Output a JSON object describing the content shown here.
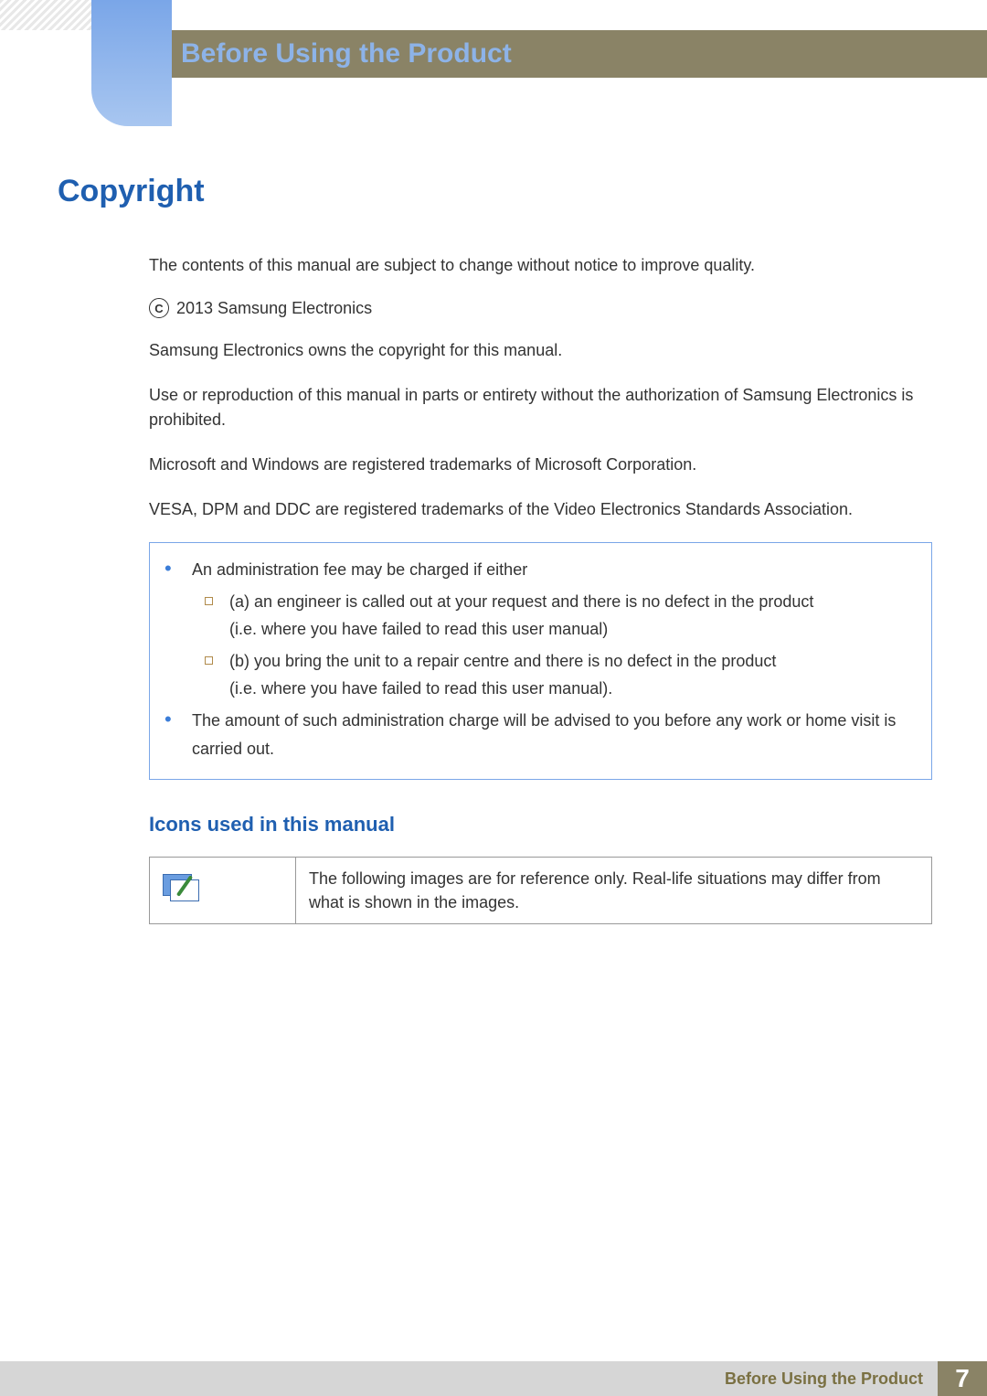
{
  "header": {
    "title": "Before Using the Product"
  },
  "section": {
    "title": "Copyright"
  },
  "copyright": {
    "p1": "The contents of this manual are subject to change without notice to improve quality.",
    "c_label": "C",
    "year_owner": "2013 Samsung Electronics",
    "p2": "Samsung Electronics owns the copyright for this manual.",
    "p3": "Use or reproduction of this manual in parts or entirety without the authorization of Samsung Electronics is prohibited.",
    "p4": "Microsoft and Windows are registered trademarks of Microsoft Corporation.",
    "p5": "VESA, DPM and DDC are registered trademarks of the Video Electronics Standards Association."
  },
  "notice": {
    "item1": "An administration fee may be charged if either",
    "sub_a_1": "(a) an engineer is called out at your request and there is no defect in the product",
    "sub_a_2": "(i.e. where you have failed to read this user manual)",
    "sub_b_1": "(b) you bring the unit to a repair centre and there is no defect in the product",
    "sub_b_2": "(i.e. where you have failed to read this user manual).",
    "item2": "The amount of such administration charge will be advised to you before any work or home visit is carried out."
  },
  "icons_section": {
    "title": "Icons used in this manual",
    "row1_desc": "The following images are for reference only. Real-life situations may differ from what is shown in the images."
  },
  "footer": {
    "label": "Before Using the Product",
    "page": "7"
  }
}
